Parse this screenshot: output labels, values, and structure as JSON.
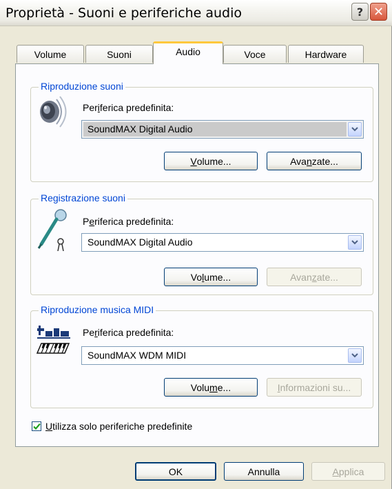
{
  "window": {
    "title": "Proprietà - Suoni e periferiche audio",
    "help_label": "?",
    "close_label": "✕"
  },
  "tabs": [
    {
      "label": "Volume"
    },
    {
      "label": "Suoni"
    },
    {
      "label": "Audio",
      "active": true
    },
    {
      "label": "Voce"
    },
    {
      "label": "Hardware"
    }
  ],
  "playback": {
    "group_title": "Riproduzione suoni",
    "device_label_pre": "Per",
    "device_label_ul": "i",
    "device_label_post": "ferica predefinita:",
    "device_value": "SoundMAX Digital Audio",
    "volume_pre": "",
    "volume_ul": "V",
    "volume_post": "olume...",
    "advanced_pre": "Ava",
    "advanced_ul": "n",
    "advanced_post": "zate..."
  },
  "recording": {
    "group_title": "Registrazione suoni",
    "device_label_pre": "P",
    "device_label_ul": "e",
    "device_label_post": "riferica predefinita:",
    "device_value": "SoundMAX Digital Audio",
    "volume_pre": "Vo",
    "volume_ul": "l",
    "volume_post": "ume...",
    "advanced_pre": "Avan",
    "advanced_ul": "z",
    "advanced_post": "ate..."
  },
  "midi": {
    "group_title": "Riproduzione musica MIDI",
    "device_label_pre": "Pe",
    "device_label_ul": "r",
    "device_label_post": "iferica predefinita:",
    "device_value": "SoundMAX WDM MIDI",
    "volume_pre": "Volu",
    "volume_ul": "m",
    "volume_post": "e...",
    "about_pre": "",
    "about_ul": "I",
    "about_post": "nformazioni su..."
  },
  "default_only": {
    "checked": true,
    "label_pre": "",
    "label_ul": "U",
    "label_post": "tilizza solo periferiche predefinite"
  },
  "footer": {
    "ok_label": "OK",
    "cancel_label": "Annulla",
    "apply_pre": "",
    "apply_ul": "A",
    "apply_post": "pplica"
  },
  "colors": {
    "group_title": "#0046d5",
    "active_tab_accent": "#ffc83c",
    "button_border": "#003c74",
    "check_mark": "#21a121"
  },
  "icons": [
    "speaker-icon",
    "microphone-icon",
    "midi-keyboard-icon",
    "chevron-down-icon",
    "check-icon",
    "help-icon",
    "close-icon"
  ]
}
